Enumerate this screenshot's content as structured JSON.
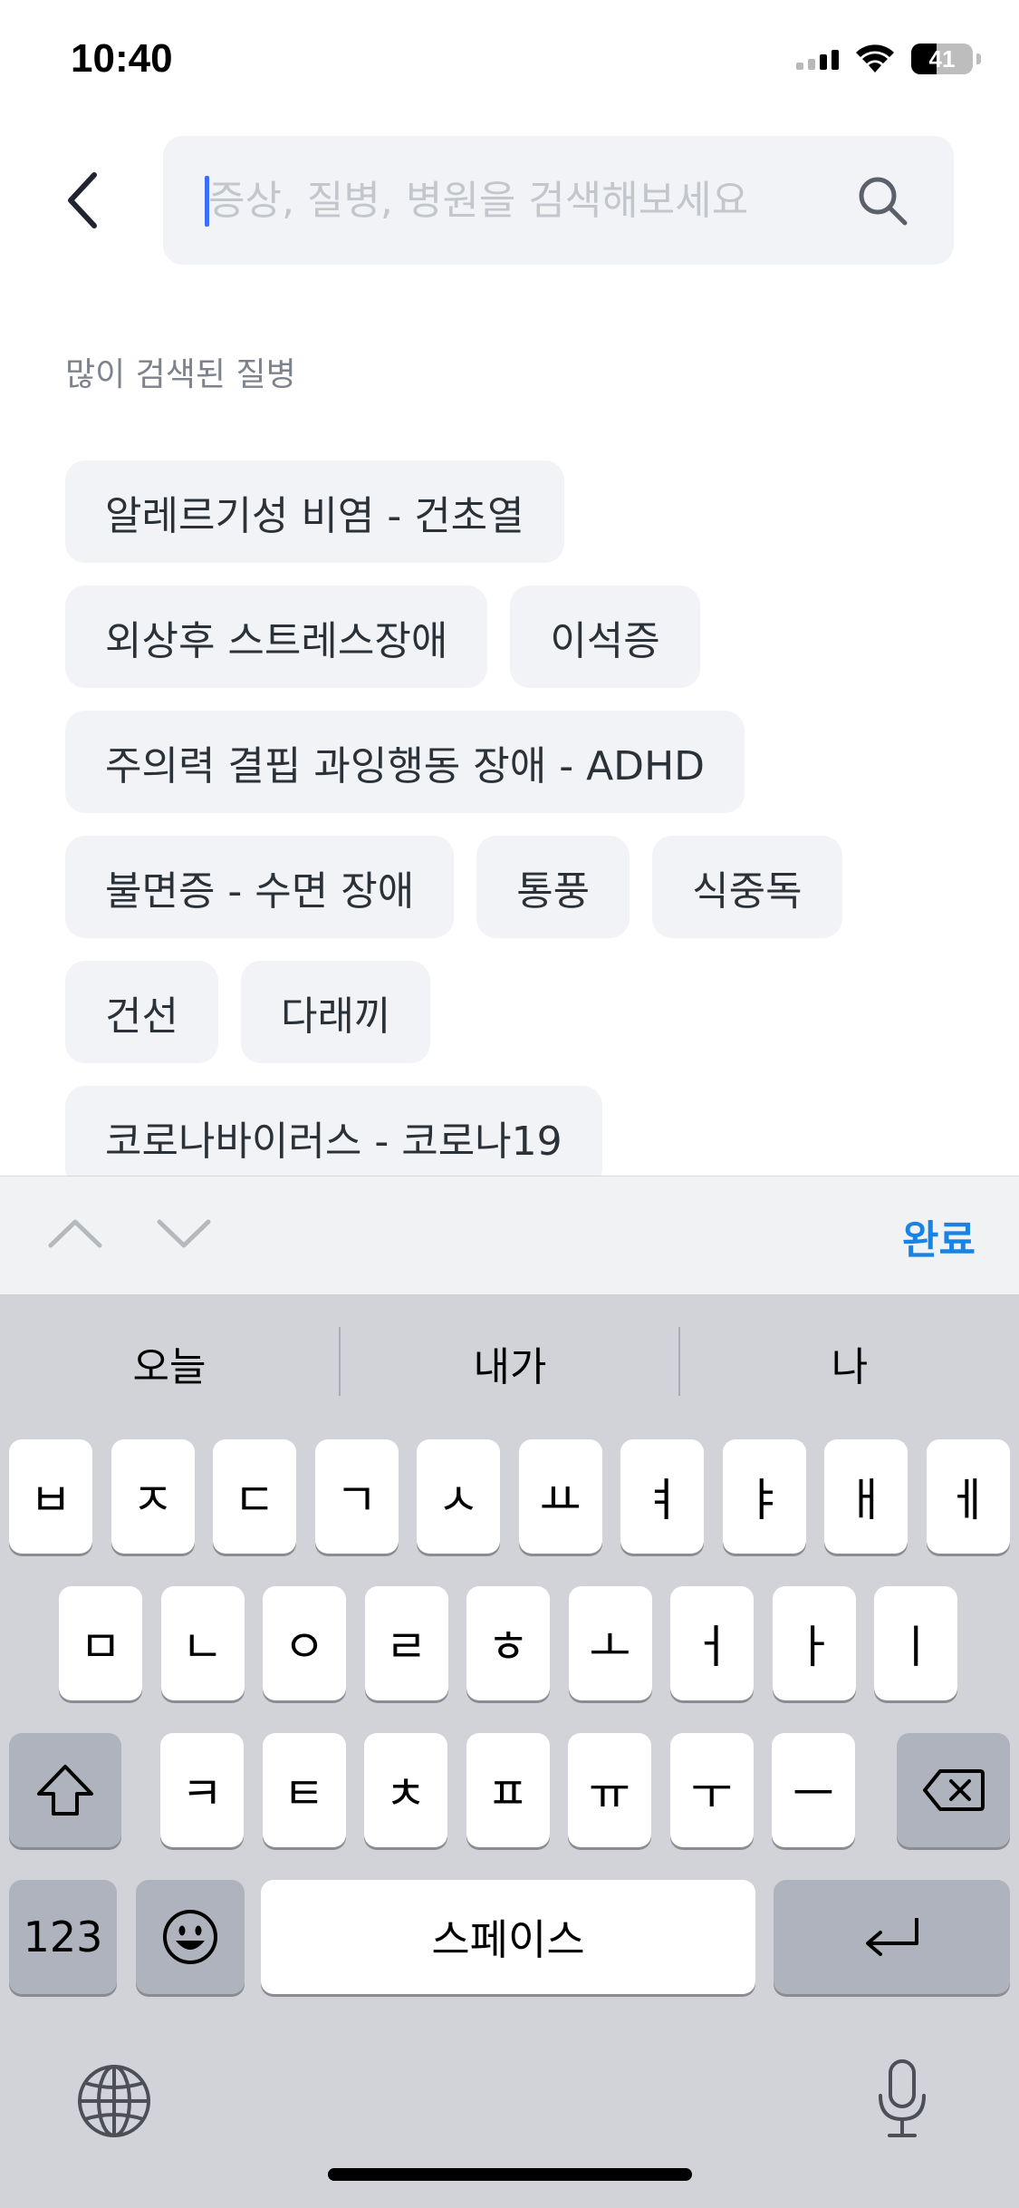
{
  "status_bar": {
    "time": "10:40",
    "battery": "41"
  },
  "search": {
    "placeholder": "증상, 질병, 병원을 검색해보세요",
    "value": ""
  },
  "section_title": "많이 검색된 질병",
  "chip_rows": [
    [
      "알레르기성 비염 - 건초열"
    ],
    [
      "외상후 스트레스장애",
      "이석증"
    ],
    [
      "주의력 결핍 과잉행동 장애 - ADHD"
    ],
    [
      "불면증 - 수면 장애",
      "통풍",
      "식중독"
    ],
    [
      "건선",
      "다래끼"
    ],
    [
      "코로나바이러스 - 코로나19"
    ]
  ],
  "accessory": {
    "done_label": "완료"
  },
  "keyboard": {
    "suggestions": [
      "오늘",
      "내가",
      "나"
    ],
    "row1": [
      "ㅂ",
      "ㅈ",
      "ㄷ",
      "ㄱ",
      "ㅅ",
      "ㅛ",
      "ㅕ",
      "ㅑ",
      "ㅐ",
      "ㅔ"
    ],
    "row2": [
      "ㅁ",
      "ㄴ",
      "ㅇ",
      "ㄹ",
      "ㅎ",
      "ㅗ",
      "ㅓ",
      "ㅏ",
      "ㅣ"
    ],
    "row3": [
      "ㅋ",
      "ㅌ",
      "ㅊ",
      "ㅍ",
      "ㅠ",
      "ㅜ",
      "ㅡ"
    ],
    "numbers_label": "123",
    "space_label": "스페이스"
  },
  "icons": {
    "back": "chevron-left-icon",
    "search": "search-icon",
    "shift": "shift-icon",
    "delete": "delete-icon",
    "emoji": "emoji-icon",
    "return": "return-icon",
    "globe": "globe-icon",
    "mic": "microphone-icon"
  },
  "colors": {
    "accent": "#1683e5",
    "chip_bg": "#f2f3f6",
    "keyboard_bg": "#d1d3d9"
  }
}
